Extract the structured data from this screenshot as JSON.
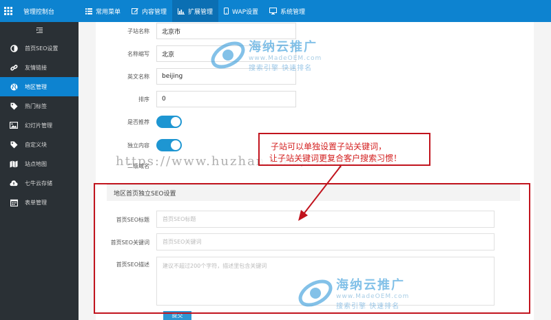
{
  "topbar": {
    "brand": "管理控制台",
    "nav": [
      {
        "label": "常用菜单",
        "icon": "list-icon"
      },
      {
        "label": "内容管理",
        "icon": "edit-icon"
      },
      {
        "label": "扩展管理",
        "icon": "bar-chart-icon"
      },
      {
        "label": "WAP设置",
        "icon": "mobile-icon"
      },
      {
        "label": "系统管理",
        "icon": "monitor-icon"
      }
    ],
    "active_nav": "扩展管理"
  },
  "sidebar": {
    "toggle_icon": "menu-collapse-icon",
    "items": [
      {
        "label": "首页SEO设置",
        "icon": "half-circle-icon"
      },
      {
        "label": "友情链接",
        "icon": "link-icon"
      },
      {
        "label": "地区管理",
        "icon": "globe-icon"
      },
      {
        "label": "热门标签",
        "icon": "tag-icon"
      },
      {
        "label": "幻灯片管理",
        "icon": "image-icon"
      },
      {
        "label": "自定义块",
        "icon": "tag-icon"
      },
      {
        "label": "站点地图",
        "icon": "map-icon"
      },
      {
        "label": "七牛云存储",
        "icon": "cloud-upload-icon"
      },
      {
        "label": "表单管理",
        "icon": "calendar-icon"
      }
    ],
    "active_item": "地区管理"
  },
  "form": {
    "subsite_name": {
      "label": "子站名称",
      "value": "北京市"
    },
    "short_name": {
      "label": "名称缩写",
      "value": "北京"
    },
    "english_name": {
      "label": "英文名称",
      "value": "beijing"
    },
    "sort": {
      "label": "排序",
      "value": "0"
    },
    "recommend": {
      "label": "是否推荐",
      "on": true
    },
    "independent": {
      "label": "独立内容",
      "on": true
    },
    "second_domain": {
      "label": "二级域名"
    }
  },
  "seo": {
    "section_title": "地区首页独立SEO设置",
    "title_field": {
      "label": "首页SEO标题",
      "placeholder": "首页SEO标题"
    },
    "keywords_field": {
      "label": "首页SEO关键词",
      "placeholder": "首页SEO关键词"
    },
    "desc_field": {
      "label": "首页SEO描述",
      "placeholder": "建议不超过200个字符，描述里包含关键词"
    },
    "submit": "提交"
  },
  "annotation": {
    "line1": "子站可以单独设置子站关键词，",
    "line2": "让子站关键词更复合客户搜索习惯！",
    "color": "#c1131d"
  },
  "watermark": {
    "url": "https://www.huzhan.com/ishop21765",
    "logo_title": "海纳云推广",
    "logo_site": "www.MadeOEM.com",
    "logo_slogan": "搜索引擎 快速排名"
  },
  "colors": {
    "primary": "#0d83d0",
    "sidebar_bg": "#2a3035",
    "toggle_on": "#1e96d2"
  }
}
